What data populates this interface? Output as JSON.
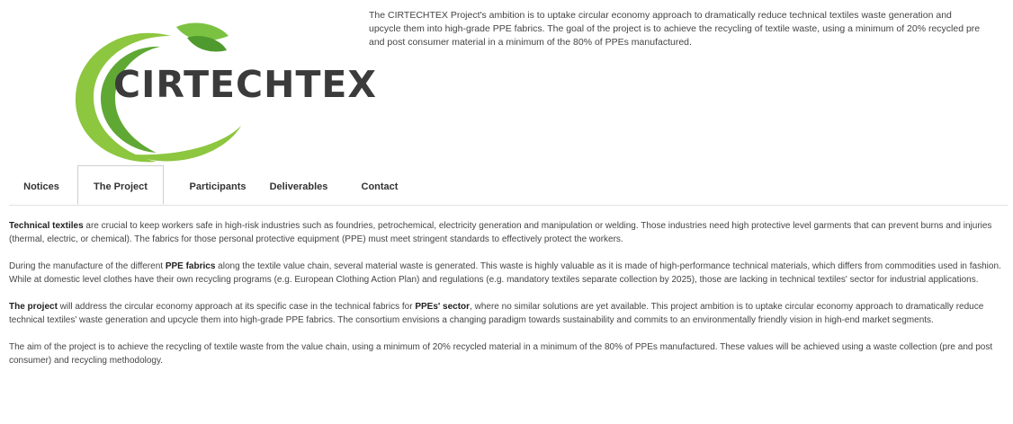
{
  "logo": {
    "text": "CIRTECHTEX",
    "accent_green": "#8dc63f",
    "dark_green": "#3f8a2a"
  },
  "intro": "The CIRTECHTEX Project's ambition is to uptake circular economy approach to dramatically reduce technical textiles waste generation and upcycle them into high-grade PPE fabrics. The goal of the project is to achieve the recycling of textile waste, using a minimum of 20% recycled pre and post consumer material in a minimum of the 80% of PPEs manufactured.",
  "tabs": [
    {
      "label": "Notices",
      "active": false
    },
    {
      "label": "The Project",
      "active": true
    },
    {
      "label": "Participants",
      "active": false
    },
    {
      "label": "Deliverables",
      "active": false
    },
    {
      "label": "Contact",
      "active": false
    }
  ],
  "paragraphs": [
    {
      "lead": "Technical textiles",
      "text": " are crucial to keep workers safe in high-risk industries such as foundries, petrochemical, electricity generation and manipulation or welding. Those industries need high protective level garments that can prevent burns and injuries (thermal, electric, or chemical). The fabrics for those personal protective equipment (PPE) must meet stringent standards to effectively protect the workers."
    },
    {
      "pre": "During the manufacture of the different ",
      "bold": "PPE fabrics",
      "text": " along the textile value chain, several material waste is generated. This waste is highly valuable as it is made of high-performance technical materials, which differs from commodities used in fashion. While at domestic level clothes have their own recycling programs (e.g. European Clothing Action Plan) and regulations (e.g. mandatory textiles separate collection by 2025), those are lacking in technical textiles' sector for industrial applications."
    },
    {
      "lead": "The project",
      "mid": " will address the circular economy approach at its specific case in the technical fabrics for ",
      "bold": "PPEs' sector",
      "text": ", where no similar solutions are yet available. This project ambition is to uptake circular economy approach to dramatically reduce technical textiles' waste generation and upcycle them into high-grade PPE fabrics. The consortium envisions a changing paradigm towards sustainability and commits to an environmentally friendly vision in high-end market segments."
    },
    {
      "text": "The aim of the project is to achieve the recycling of textile waste from the value chain, using a minimum of 20% recycled material in a minimum of the 80% of PPEs manufactured. These values will be achieved using a waste collection (pre and post consumer) and recycling methodology."
    }
  ]
}
